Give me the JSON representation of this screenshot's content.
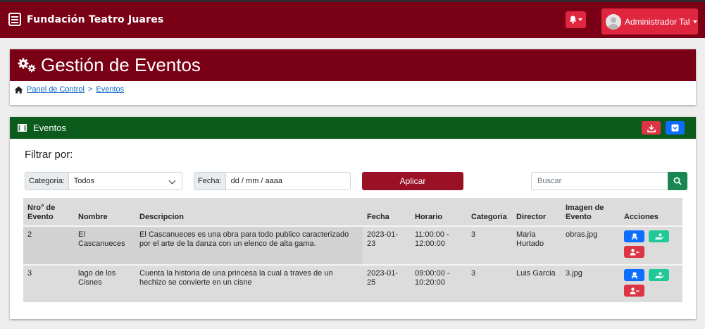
{
  "navbar": {
    "brand": "Fundación Teatro Juares",
    "user_name": "Administrador Tal"
  },
  "header": {
    "title": "Gestión de Eventos",
    "breadcrumb": [
      "Panel de Control",
      ">",
      "Eventos"
    ]
  },
  "events_card": {
    "title": "Eventos",
    "filter_title": "Filtrar por:",
    "category_label": "Categoria:",
    "category_value": "Todos",
    "date_label": "Fecha:",
    "date_value": "dd / mm / aaaa",
    "apply_label": "Aplicar",
    "search_placeholder": "Buscar"
  },
  "table": {
    "headers": [
      "Nro° de Evento",
      "Nombre",
      "Descripcion",
      "Fecha",
      "Horario",
      "Categoria",
      "Director",
      "Imagen de Evento",
      "Acciones"
    ],
    "rows": [
      {
        "nro": "2",
        "nombre": "El Cascanueces",
        "descripcion": "El Cascanueces es una obra para todo publico caracterizado por el arte de la danza con un elenco de alta gama.",
        "fecha": "2023-01-23",
        "horario": "11:00:00 - 12:00:00",
        "categoria": "3",
        "director": "Maria Hurtado",
        "imagen": "obras.jpg"
      },
      {
        "nro": "3",
        "nombre": "lago de los Cisnes",
        "descripcion": "Cuenta la historia de una princesa la cual a traves de un hechizo se convierte en un cisne",
        "fecha": "2023-01-25",
        "horario": "09:00:00 - 10:20:00",
        "categoria": "3",
        "director": "Luis Garcia",
        "imagen": "3.jpg"
      }
    ]
  },
  "colors": {
    "navbar": "#7a0016",
    "accent_red": "#e0263f",
    "events_header": "#0c5a1c",
    "apply": "#9a1024"
  },
  "icons": [
    "menu-icon",
    "bell-icon",
    "user-avatar-icon",
    "gears-icon",
    "home-icon",
    "film-icon",
    "download-icon",
    "archive-icon",
    "search-icon",
    "seat-icon",
    "handshake-icon",
    "user-remove-icon"
  ]
}
